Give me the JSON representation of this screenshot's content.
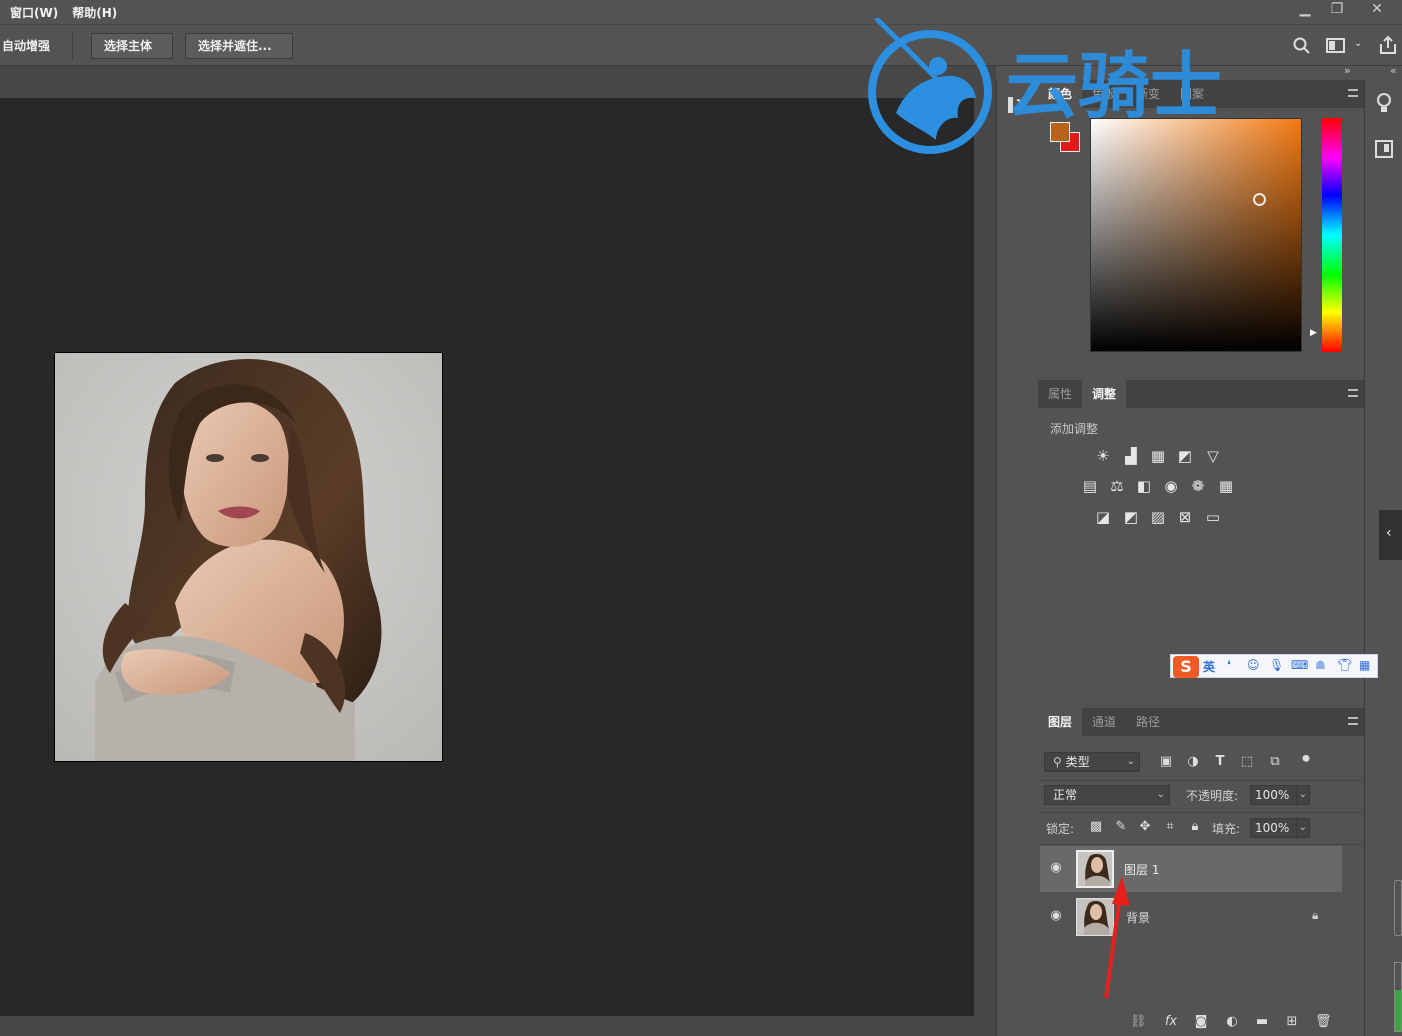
{
  "menubar": {
    "items": [
      "窗口(W)",
      "帮助(H)"
    ]
  },
  "window_controls": {
    "minimize": "▁",
    "restore": "❐",
    "close": "✕"
  },
  "options_bar": {
    "auto_enhance": "自动增强",
    "select_subject": "选择主体",
    "select_and_mask": "选择并遮住..."
  },
  "watermark": {
    "text": "云骑士"
  },
  "color_panel": {
    "tabs": [
      "颜色",
      "色板",
      "渐变",
      "图案"
    ],
    "accent": "#f27a12",
    "foreground": "#b8611a",
    "background": "#e01b1b"
  },
  "adjust_panel": {
    "tabs": [
      "属性",
      "调整"
    ],
    "add_adjustment": "添加调整"
  },
  "ime_bar": {
    "logo": "S",
    "mode": "英"
  },
  "layers_panel": {
    "tabs": [
      "图层",
      "通道",
      "路径"
    ],
    "filter_kind": "类型",
    "blend_mode": "正常",
    "opacity_label": "不透明度:",
    "opacity_value": "100%",
    "lock_label": "锁定:",
    "fill_label": "填充:",
    "fill_value": "100%",
    "layers": [
      {
        "name": "图层 1",
        "selected": true
      },
      {
        "name": "背景",
        "locked": true
      }
    ]
  }
}
